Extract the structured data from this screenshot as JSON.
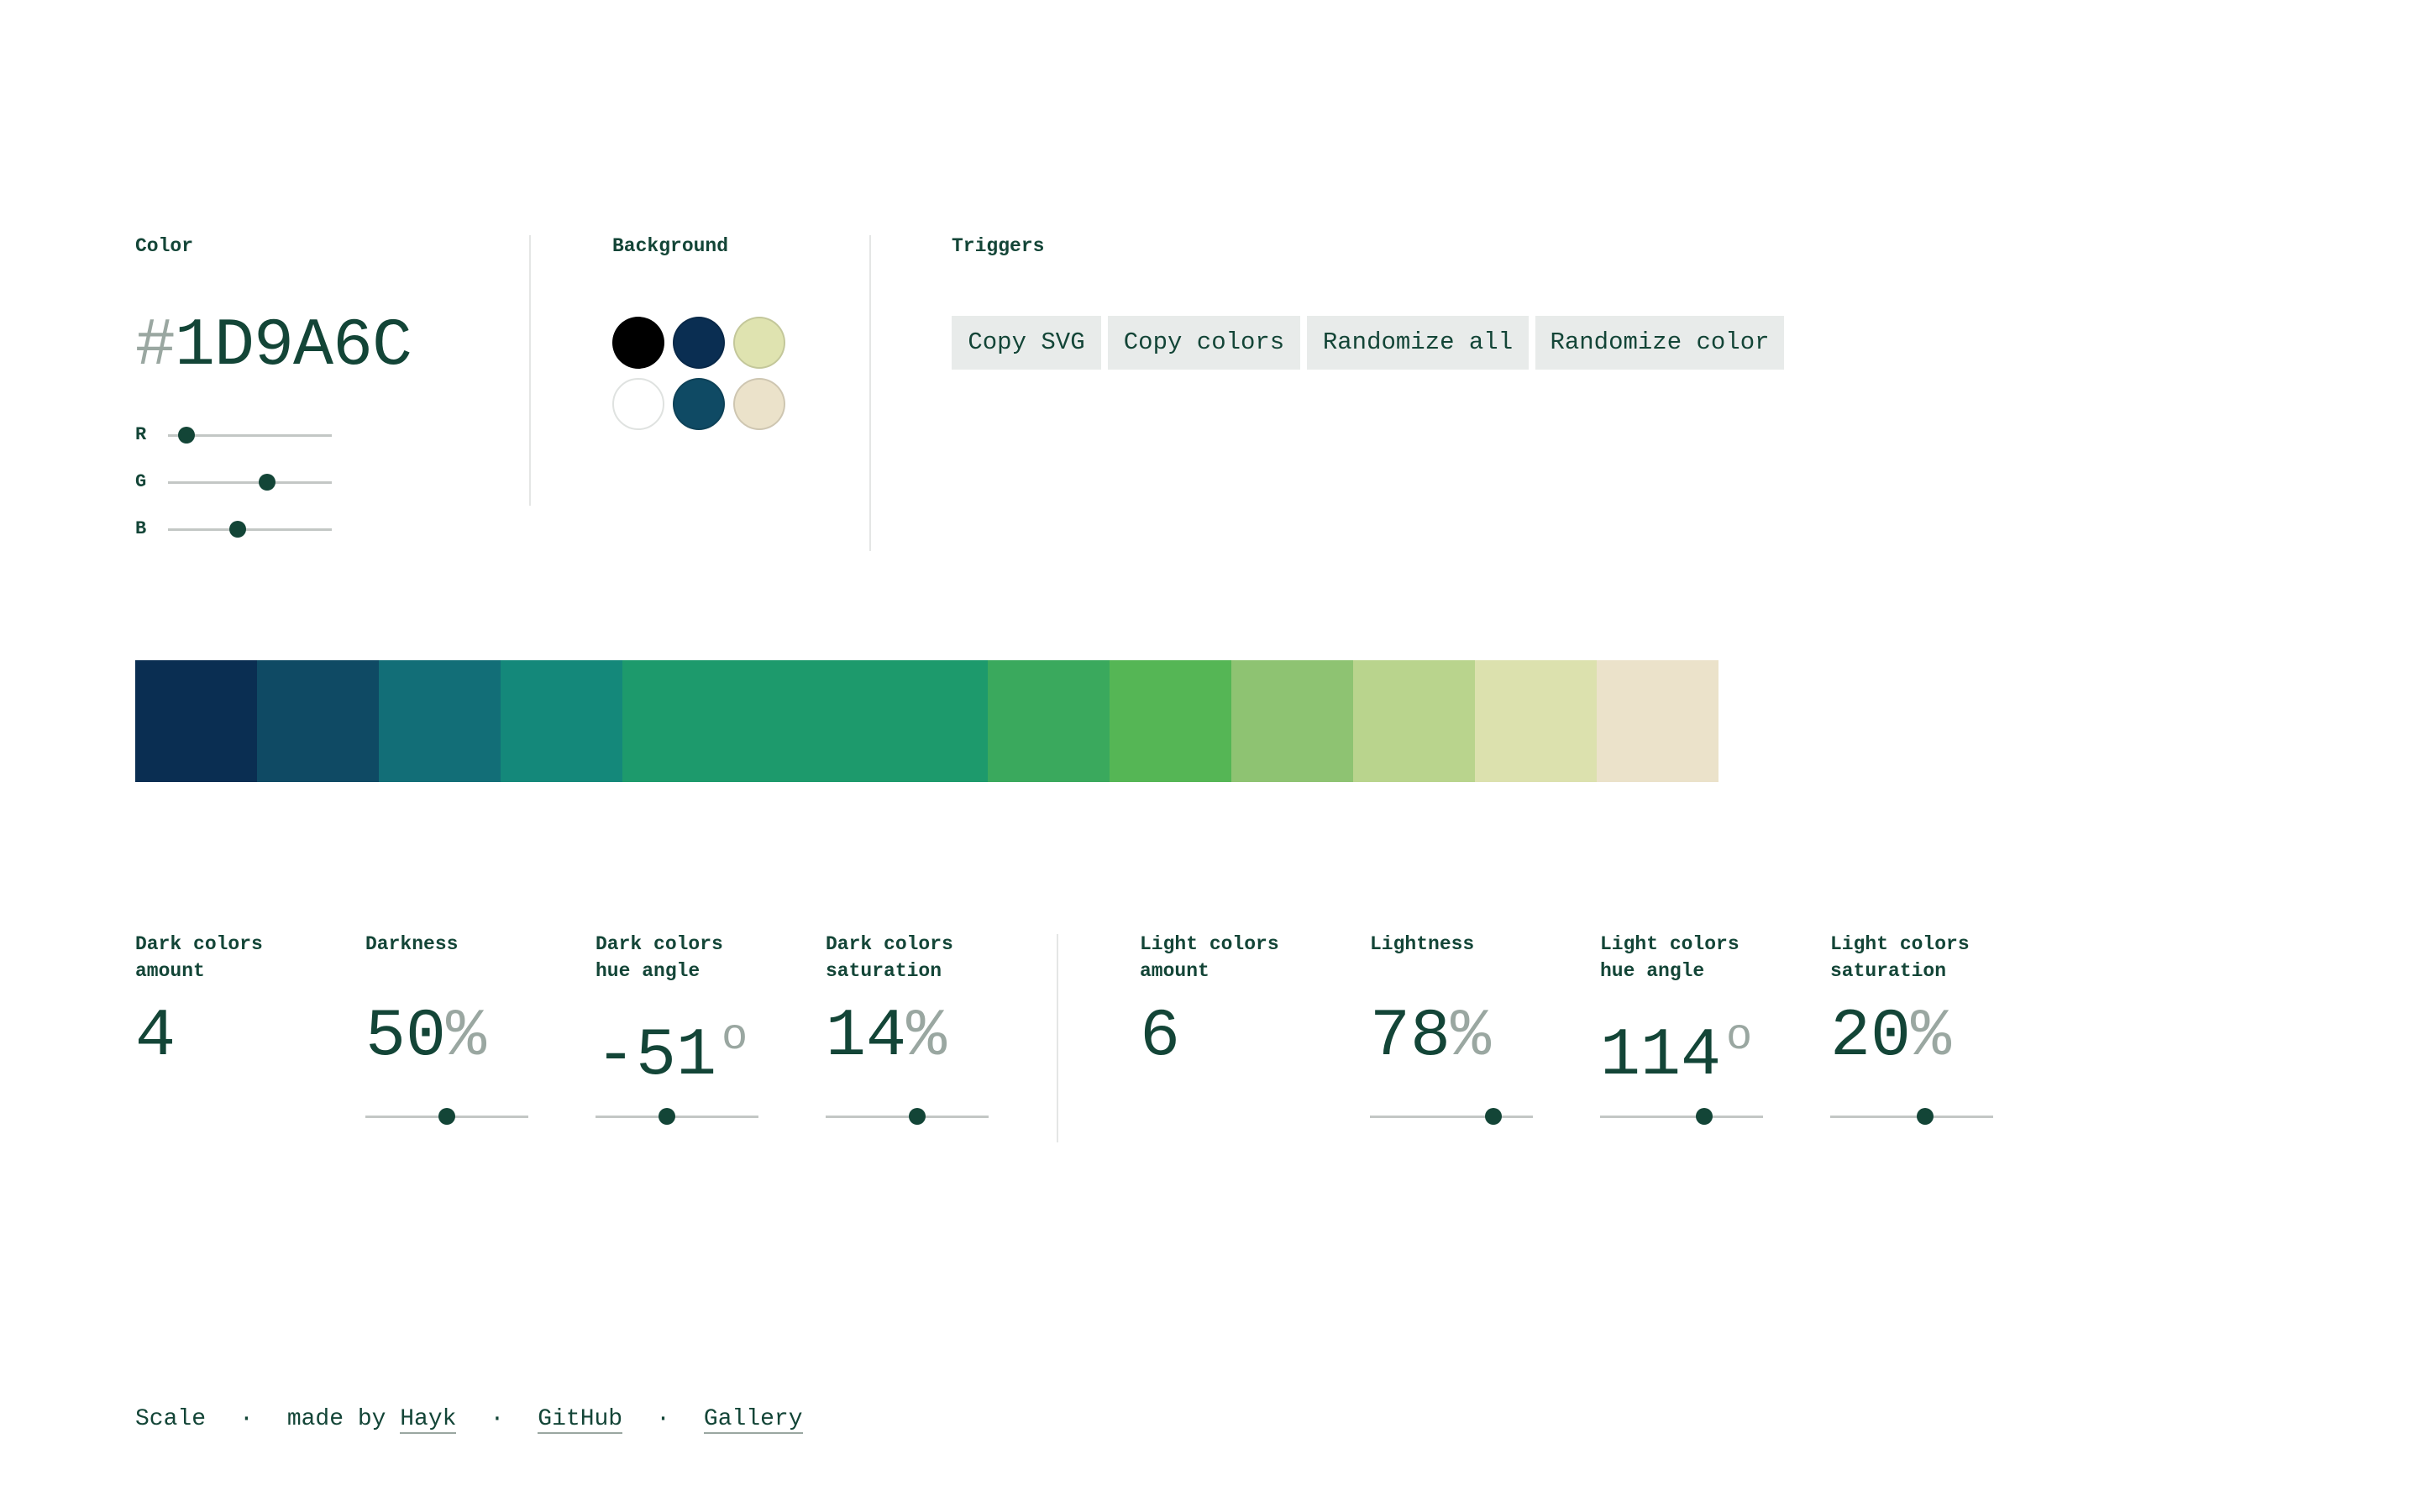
{
  "color_section": {
    "label": "Color",
    "hash": "#",
    "hex": "1D9A6C",
    "channels": [
      {
        "label": "R",
        "value": 29,
        "max": 255
      },
      {
        "label": "G",
        "value": 154,
        "max": 255
      },
      {
        "label": "B",
        "value": 108,
        "max": 255
      }
    ]
  },
  "background_section": {
    "label": "Background",
    "swatches": [
      "#000000",
      "#0a2e52",
      "#dfe3b0",
      "#ffffff",
      "#0f4a64",
      "#ebe2ca"
    ]
  },
  "triggers_section": {
    "label": "Triggers",
    "buttons": [
      "Copy SVG",
      "Copy colors",
      "Randomize all",
      "Randomize color"
    ]
  },
  "scale_colors": [
    "#0a2e52",
    "#0f4a64",
    "#126e77",
    "#14887a",
    "#1d9a6c",
    "#1d9a6c",
    "#1d9a6c",
    "#3aa95d",
    "#55b655",
    "#8ec372",
    "#b9d48d",
    "#dce1ae",
    "#ebe2ca"
  ],
  "params": {
    "dark_amount": {
      "label": "Dark colors\namount",
      "value": "4"
    },
    "darkness": {
      "label": "Darkness",
      "value": "50",
      "unit": "%",
      "slider": 0.5
    },
    "dark_hue": {
      "label": "Dark colors\nhue angle",
      "value": "-51",
      "unit": "o",
      "slider": 0.44
    },
    "dark_saturation": {
      "label": "Dark colors\nsaturation",
      "value": "14",
      "unit": "%",
      "slider": 0.56
    },
    "light_amount": {
      "label": "Light colors\namount",
      "value": "6"
    },
    "lightness": {
      "label": "Lightness",
      "value": "78",
      "unit": "%",
      "slider": 0.76
    },
    "light_hue": {
      "label": "Light colors\nhue angle",
      "value": "114",
      "unit": "o",
      "slider": 0.64
    },
    "light_saturation": {
      "label": "Light colors\nsaturation",
      "value": "20",
      "unit": "%",
      "slider": 0.58
    }
  },
  "footer": {
    "app": "Scale",
    "sep": "·",
    "made_by": "made by ",
    "author": "Hayk",
    "github": "GitHub",
    "gallery": "Gallery"
  },
  "colors": {
    "primary_text": "#134537",
    "muted": "#9aa7a1",
    "button_bg": "#e8ebea"
  }
}
